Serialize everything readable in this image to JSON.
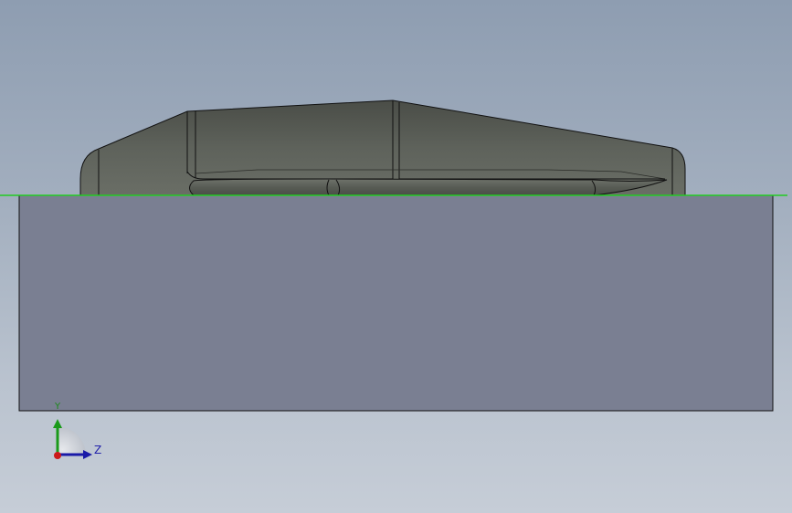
{
  "viewport": {
    "background_top": "#8e9db1",
    "background_bottom": "#c6cdd7"
  },
  "model": {
    "block_color": "#7a7f92",
    "part_color": "#5b5f58",
    "edge_color": "#111111",
    "ground_line_color": "#22cc22"
  },
  "triad": {
    "y_label": "Y",
    "z_label": "Z",
    "y_color": "#1a9a1a",
    "z_color": "#1a1aa8",
    "x_color": "#cc1a1a"
  }
}
